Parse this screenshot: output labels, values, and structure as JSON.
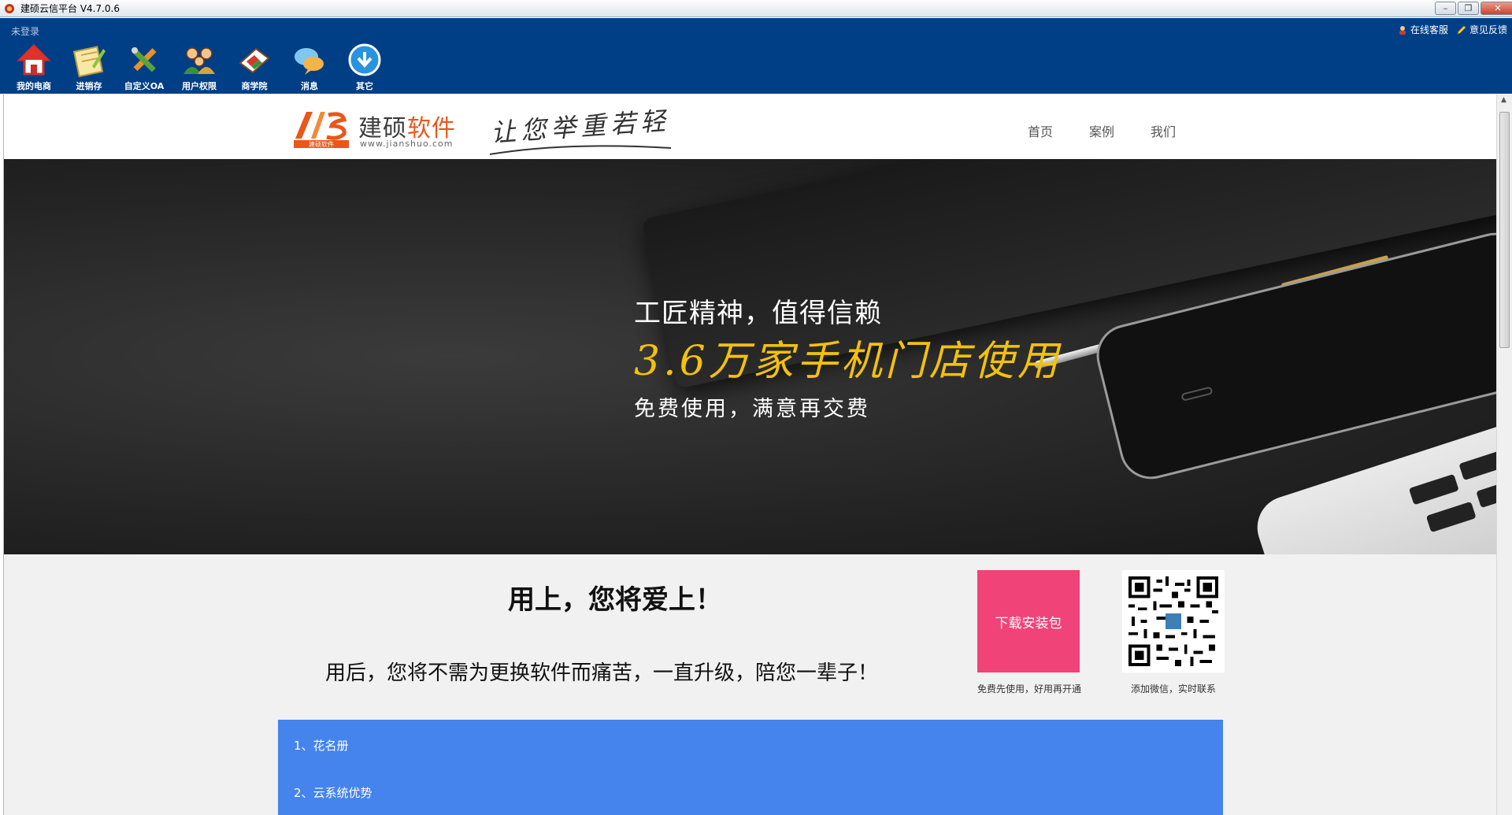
{
  "window": {
    "title": "建硕云信平台  V4.7.0.6",
    "controls": {
      "minimize": "–",
      "restore": "❐",
      "close": "✕"
    }
  },
  "toolbar": {
    "login_status": "未登录",
    "links": [
      {
        "label": "在线客服",
        "icon": "headset-icon"
      },
      {
        "label": "意见反馈",
        "icon": "pencil-icon"
      }
    ],
    "tools": [
      {
        "label": "我的电商",
        "icon": "home-icon"
      },
      {
        "label": "进销存",
        "icon": "notepad-icon"
      },
      {
        "label": "自定义OA",
        "icon": "tools-icon"
      },
      {
        "label": "用户权限",
        "icon": "users-icon"
      },
      {
        "label": "商学院",
        "icon": "book-icon"
      },
      {
        "label": "消息",
        "icon": "chat-icon"
      },
      {
        "label": "其它",
        "icon": "download-icon"
      }
    ]
  },
  "site": {
    "logo": {
      "text_a": "建硕",
      "text_b": "软件",
      "url": "www.jianshuo.com",
      "mark_caption": "建硕软件"
    },
    "slogan": "让您举重若轻",
    "nav": [
      "首页",
      "案例",
      "我们"
    ]
  },
  "hero": {
    "line1": "工匠精神，值得信赖",
    "line2": "3.6万家手机门店使用",
    "line3": "免费使用，满意再交费"
  },
  "content": {
    "headline": "用上，您将爱上！",
    "subline": "用后，您将不需为更换软件而痛苦，一直升级，陪您一辈子！",
    "download": {
      "label": "下载安装包",
      "caption": "免费先使用，好用再开通"
    },
    "qr": {
      "caption": "添加微信，实时联系"
    },
    "features": [
      "1、花名册",
      "2、云系统优势"
    ]
  },
  "colors": {
    "toolbar_bg": "#003f86",
    "download_btn": "#f04377",
    "features_bg": "#4484ec",
    "hero_accent": "#f3c10d"
  }
}
